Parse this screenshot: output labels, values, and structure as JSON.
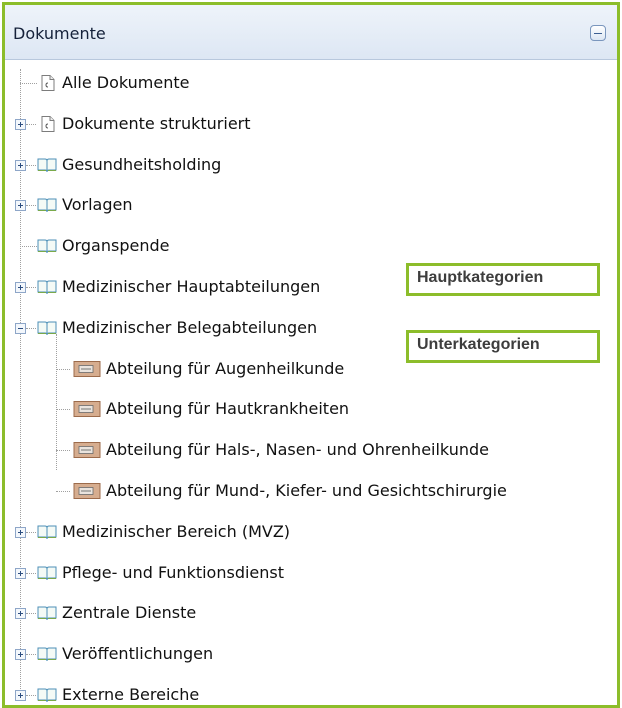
{
  "panel": {
    "title": "Dokumente",
    "collapse_icon": "minus-icon"
  },
  "tree": [
    {
      "label": "Alle Dokumente",
      "icon": "document-icon",
      "expander": "none"
    },
    {
      "label": "Dokumente strukturiert",
      "icon": "document-icon",
      "expander": "plus"
    },
    {
      "label": "Gesundheitsholding",
      "icon": "book-icon",
      "expander": "plus"
    },
    {
      "label": "Vorlagen",
      "icon": "book-icon",
      "expander": "plus"
    },
    {
      "label": "Organspende",
      "icon": "book-icon",
      "expander": "none"
    },
    {
      "label": "Medizinischer Hauptabteilungen",
      "icon": "book-icon",
      "expander": "plus"
    },
    {
      "label": "Medizinischer Belegabteilungen",
      "icon": "book-icon",
      "expander": "minus",
      "children": [
        {
          "label": "Abteilung für Augenheilkunde",
          "icon": "category-icon"
        },
        {
          "label": "Abteilung für Hautkrankheiten",
          "icon": "category-icon"
        },
        {
          "label": "Abteilung für Hals-, Nasen- und Ohrenheilkunde",
          "icon": "category-icon"
        },
        {
          "label": "Abteilung für Mund-, Kiefer- und Gesichtschirurgie",
          "icon": "category-icon"
        }
      ]
    },
    {
      "label": "Medizinischer Bereich (MVZ)",
      "icon": "book-icon",
      "expander": "plus"
    },
    {
      "label": "Pflege- und Funktionsdienst",
      "icon": "book-icon",
      "expander": "plus"
    },
    {
      "label": "Zentrale Dienste",
      "icon": "book-icon",
      "expander": "plus"
    },
    {
      "label": "Veröffentlichungen",
      "icon": "book-icon",
      "expander": "plus"
    },
    {
      "label": "Externe Bereiche",
      "icon": "book-icon",
      "expander": "plus"
    }
  ],
  "callouts": {
    "main": "Hauptkategorien",
    "sub": "Unterkategorien"
  },
  "colors": {
    "highlight_border": "#8cbd2a"
  }
}
